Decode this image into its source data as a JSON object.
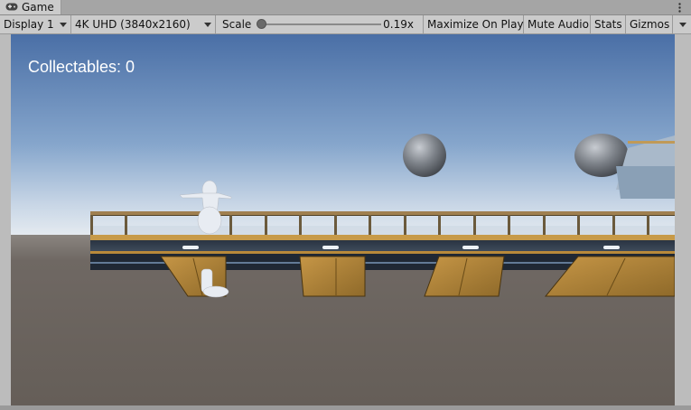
{
  "tab": {
    "title": "Game",
    "icon": "gamepad-icon"
  },
  "toolbar": {
    "display": "Display 1",
    "resolution": "4K UHD (3840x2160)",
    "scale_label": "Scale",
    "scale_value": "0.19x",
    "maximize_on_play": "Maximize On Play",
    "mute_audio": "Mute Audio",
    "stats": "Stats",
    "gizmos": "Gizmos"
  },
  "hud": {
    "collectables": "Collectables: 0"
  },
  "colors": {
    "sky_top": "#4a6fa6",
    "sky_horizon": "#dfe6ee",
    "ground": "#6b6560",
    "wood": "#b8893a"
  }
}
